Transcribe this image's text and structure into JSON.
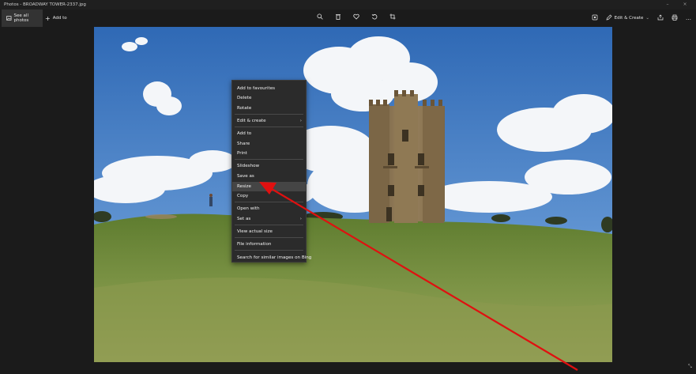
{
  "window": {
    "title": "Photos - BROADWAY TOWER-2337.jpg",
    "minimize_glyph": "–",
    "close_glyph": "×"
  },
  "toolbar": {
    "see_all_photos": "See all photos",
    "add_to": "Add to",
    "edit_create": "Edit & Create",
    "icons": [
      "zoom-icon",
      "delete-icon",
      "favourite-icon",
      "rotate-icon",
      "crop-icon",
      "enhance-icon",
      "share-icon",
      "print-icon",
      "more-icon"
    ]
  },
  "context_menu": {
    "items": [
      {
        "label": "Add to favourites",
        "submenu": false,
        "highlighted": false
      },
      {
        "label": "Delete",
        "submenu": false,
        "highlighted": false
      },
      {
        "label": "Rotate",
        "submenu": false,
        "highlighted": false
      },
      {
        "label": "Edit & create",
        "submenu": true,
        "highlighted": false
      },
      {
        "label": "Add to",
        "submenu": false,
        "highlighted": false
      },
      {
        "label": "Share",
        "submenu": false,
        "highlighted": false
      },
      {
        "label": "Print",
        "submenu": false,
        "highlighted": false
      },
      {
        "label": "Slideshow",
        "submenu": false,
        "highlighted": false
      },
      {
        "label": "Save as",
        "submenu": false,
        "highlighted": false
      },
      {
        "label": "Resize",
        "submenu": false,
        "highlighted": true
      },
      {
        "label": "Copy",
        "submenu": false,
        "highlighted": false
      },
      {
        "label": "Open with",
        "submenu": false,
        "highlighted": false
      },
      {
        "label": "Set as",
        "submenu": true,
        "highlighted": false
      },
      {
        "label": "View actual size",
        "submenu": false,
        "highlighted": false
      },
      {
        "label": "File information",
        "submenu": false,
        "highlighted": false
      },
      {
        "label": "Search for similar images on Bing",
        "submenu": false,
        "highlighted": false
      }
    ],
    "submenu_glyph": "›"
  },
  "colors": {
    "annotation_arrow": "#e01010",
    "menu_background": "#2b2b2b",
    "menu_highlight": "#454545",
    "sky": "#3f7cc4",
    "grass": "#6f8a3a"
  }
}
